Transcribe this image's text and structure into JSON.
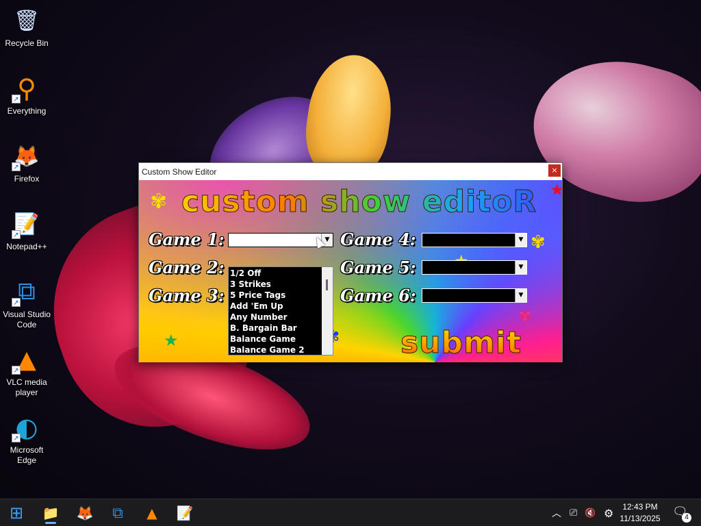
{
  "desktop": {
    "icons": [
      {
        "label": "Recycle Bin",
        "icon": "recycle-bin-icon",
        "glyph": "🗑"
      },
      {
        "label": "Everything",
        "icon": "everything-search-icon",
        "glyph": "⚲"
      },
      {
        "label": "Firefox",
        "icon": "firefox-icon",
        "glyph": "🦊"
      },
      {
        "label": "Notepad++",
        "icon": "notepad-plus-plus-icon",
        "glyph": "📝"
      },
      {
        "label": "Visual Studio Code",
        "icon": "vscode-icon",
        "glyph": "⧉"
      },
      {
        "label": "VLC media player",
        "icon": "vlc-icon",
        "glyph": "▲"
      },
      {
        "label": "Microsoft Edge",
        "icon": "edge-icon",
        "glyph": "◐"
      }
    ]
  },
  "window": {
    "title": "Custom Show Editor",
    "close_label": "×",
    "heading": "custom show editoR",
    "labels": {
      "game1": "Game 1:",
      "game2": "Game 2:",
      "game3": "Game 3:",
      "game4": "Game 4:",
      "game5": "Game 5:",
      "game6": "Game 6:"
    },
    "dropdown_options": [
      "1/2 Off",
      "3 Strikes",
      "5 Price Tags",
      "Add 'Em Up",
      "Any Number",
      "B. Bargain Bar",
      "Balance Game",
      "Balance Game 2"
    ],
    "submit_label": "submit"
  },
  "taskbar": {
    "apps": [
      {
        "name": "start",
        "glyph": "⊞",
        "color": "#3aa0ff"
      },
      {
        "name": "file-explorer",
        "glyph": "📁",
        "color": "#f5c518"
      },
      {
        "name": "firefox",
        "glyph": "🦊",
        "color": "#ff7a00"
      },
      {
        "name": "vscode",
        "glyph": "⧉",
        "color": "#2f8fe0"
      },
      {
        "name": "vlc",
        "glyph": "▲",
        "color": "#ff8800"
      },
      {
        "name": "notepad-plus-plus",
        "glyph": "📝",
        "color": "#8bc34a"
      }
    ],
    "tray": {
      "chevron": "︿",
      "network": "⎚",
      "volume": "🔇",
      "settings": "⚙"
    },
    "clock": {
      "time": "12:43 PM",
      "date": "11/13/2025"
    },
    "notifications": {
      "count": "4"
    }
  }
}
